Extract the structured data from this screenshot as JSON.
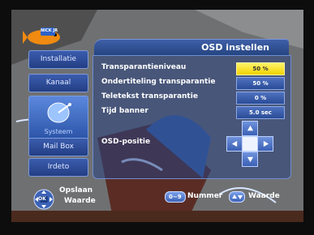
{
  "header": {
    "title": "OSD instellen"
  },
  "logo": {
    "text": "NICK JR"
  },
  "sidebar": {
    "items": [
      {
        "label": "Installatie"
      },
      {
        "label": "Kanaal"
      },
      {
        "label": "Systeem"
      },
      {
        "label": "Mail Box"
      },
      {
        "label": "Irdeto"
      }
    ]
  },
  "settings": {
    "rows": [
      {
        "label": "Transparantieniveau",
        "value": "50 %"
      },
      {
        "label": "Ondertiteling transparantie",
        "value": "50 %"
      },
      {
        "label": "Teletekst transparantie",
        "value": "0 %"
      },
      {
        "label": "Tijd banner",
        "value": "5.0 sec"
      }
    ],
    "osd_position_label": "OSD-positie"
  },
  "footer": {
    "ok_label": "OK",
    "save_label": "Opslaan",
    "value_label": "Waarde",
    "number_key": "0~9",
    "number_label": "Nummer",
    "value_key_right_label": "Waarde"
  },
  "colors": {
    "selected_value": "#f3d800",
    "panel": "#2a4c97"
  }
}
